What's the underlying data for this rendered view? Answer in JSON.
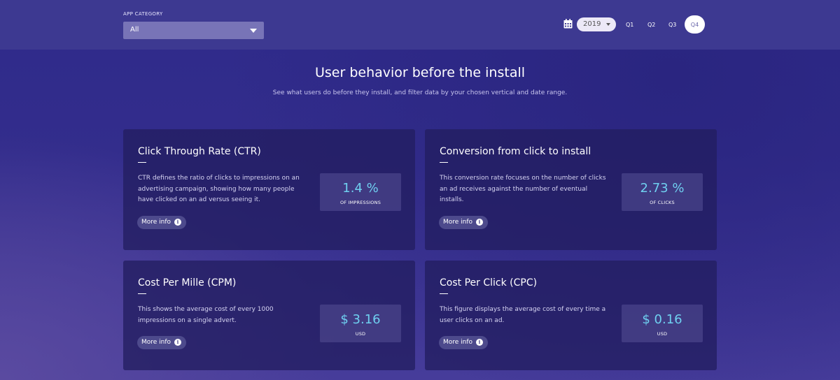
{
  "header": {
    "category_label": "APP CATEGORY",
    "category_value": "All",
    "year_value": "2019",
    "quarters": [
      "Q1",
      "Q2",
      "Q3",
      "Q4"
    ],
    "active_quarter": "Q4"
  },
  "hero": {
    "title": "User behavior before the install",
    "subtitle": "See what users do before they install, and filter data by your chosen vertical and date range."
  },
  "cards": [
    {
      "title": "Click Through Rate (CTR)",
      "description": "CTR defines the ratio of clicks to impressions on an advertising campaign, showing how many people have clicked on an ad versus seeing it.",
      "value": "1.4 %",
      "unit": "OF IMPRESSIONS",
      "button": "More info"
    },
    {
      "title": "Conversion from click to install",
      "description": "This conversion rate focuses on the number of clicks an ad receives against the number of eventual installs.",
      "value": "2.73 %",
      "unit": "OF CLICKS",
      "button": "More info"
    },
    {
      "title": "Cost Per Mille (CPM)",
      "description": "This shows the average cost of every 1000 impressions on a single advert.",
      "value": "$ 3.16",
      "unit": "USD",
      "button": "More info"
    },
    {
      "title": "Cost Per Click (CPC)",
      "description": "This figure displays the average cost of every time a user clicks on an ad.",
      "value": "$ 0.16",
      "unit": "USD",
      "button": "More info"
    }
  ],
  "colors": {
    "accent_value": "#6fd0f0",
    "topbar": "#3d3991",
    "card_bg": "#221e60"
  },
  "icons": {
    "calendar": "calendar-icon",
    "info": "info-icon",
    "dropdown": "chevron-down-icon"
  }
}
